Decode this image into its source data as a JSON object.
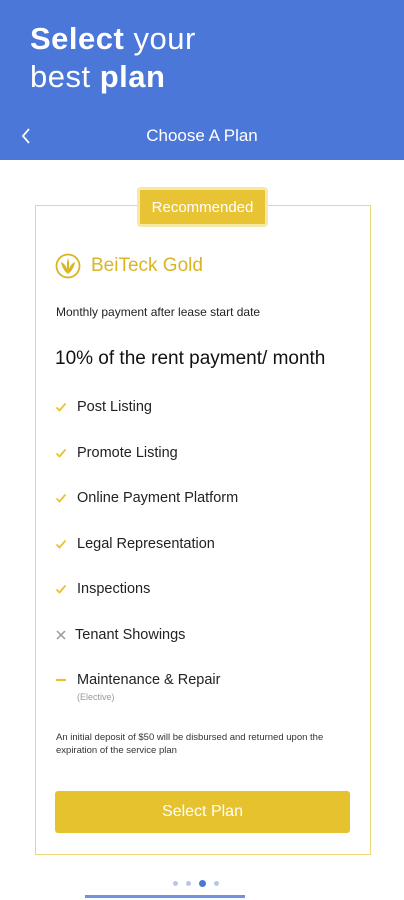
{
  "header": {
    "headline_bold_1": "Select",
    "headline_light_1": "your",
    "headline_light_2": "best",
    "headline_bold_2": "plan",
    "title": "Choose A Plan",
    "back_icon": "chevron-left-icon"
  },
  "plan": {
    "badge": "Recommended",
    "name": "BeiTeck Gold",
    "logo_icon": "leaf-sun-icon",
    "subtext": "Monthly payment after lease start date",
    "price": "10% of the rent payment/ month",
    "features": [
      {
        "label": "Post Listing",
        "status": "included"
      },
      {
        "label": "Promote Listing",
        "status": "included"
      },
      {
        "label": "Online Payment Platform",
        "status": "included"
      },
      {
        "label": "Legal Representation",
        "status": "included"
      },
      {
        "label": "Inspections",
        "status": "included"
      },
      {
        "label": "Tenant Showings",
        "status": "excluded"
      },
      {
        "label": "Maintenance & Repair",
        "status": "elective",
        "note": "(Elective)"
      }
    ],
    "footnote": "An initial deposit of $50 will be disbursed and returned upon the expiration of the service plan",
    "cta": "Select Plan"
  },
  "pager": {
    "count": 4,
    "active_index": 2
  },
  "colors": {
    "header": "#4b77d9",
    "accent": "#e6c22f",
    "check": "#e8c334",
    "excluded": "#9a9a9a"
  }
}
